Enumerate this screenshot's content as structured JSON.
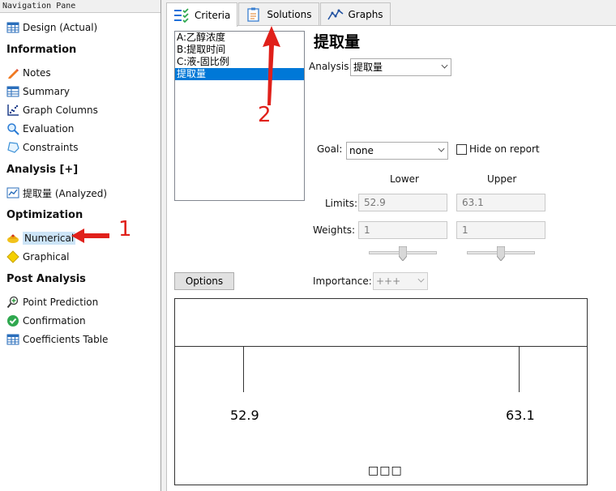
{
  "nav": {
    "title": "Navigation Pane",
    "design_item": "Design (Actual)",
    "info_header": "Information",
    "info_items": [
      "Notes",
      "Summary",
      "Graph Columns",
      "Evaluation",
      "Constraints"
    ],
    "analysis_header": "Analysis [+]",
    "analysis_item": "提取量 (Analyzed)",
    "optimization_header": "Optimization",
    "optimization_items": [
      "Numerical",
      "Graphical"
    ],
    "selected_item": "Numerical",
    "post_header": "Post Analysis",
    "post_items": [
      "Point Prediction",
      "Confirmation",
      "Coefficients Table"
    ]
  },
  "tabs": [
    {
      "label": "Criteria",
      "icon": "criteria-icon",
      "active": true
    },
    {
      "label": "Solutions",
      "icon": "clipboard-icon",
      "active": false
    },
    {
      "label": "Graphs",
      "icon": "line-chart-icon",
      "active": false
    }
  ],
  "criteria": {
    "list_items": [
      "A:乙醇浓度",
      "B:提取时间",
      "C:液-固比例",
      "提取量"
    ],
    "selected_index": 3,
    "title": "提取量",
    "analysis_label": "Analysis:",
    "analysis_value": "提取量",
    "goal_label": "Goal:",
    "goal_value": "none",
    "hide_on_report_label": "Hide on report",
    "lower_header": "Lower",
    "upper_header": "Upper",
    "limits_label": "Limits:",
    "lower_limit": "52.9",
    "upper_limit": "63.1",
    "weights_label": "Weights:",
    "lower_weight": "1",
    "upper_weight": "1",
    "options_button": "Options",
    "importance_label": "Importance:",
    "importance_value": "+++",
    "graph_low": "52.9",
    "graph_high": "63.1",
    "graph_caption": "□□□"
  },
  "annotations": {
    "arrow1_label": "1",
    "arrow2_label": "2",
    "color": "#e0201a"
  }
}
